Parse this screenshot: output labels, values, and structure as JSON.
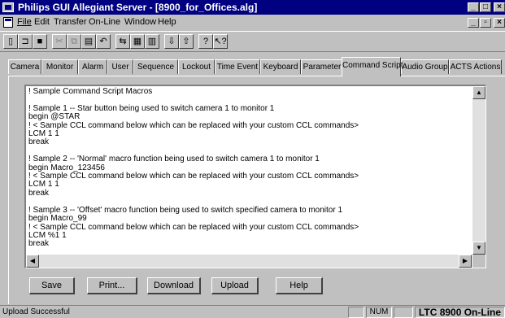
{
  "window": {
    "title": "Philips GUI Allegiant Server - [8900_for_Offices.alg]"
  },
  "menu": {
    "items": [
      "File",
      "Edit",
      "Transfer",
      "On-Line",
      "Window",
      "Help"
    ]
  },
  "toolbar": {
    "icons": [
      "new-icon",
      "open-icon",
      "save-icon",
      "cut-icon",
      "copy-icon",
      "paste-icon",
      "undo-icon",
      "transfer-icon",
      "grid-icon",
      "table-icon",
      "download-icon",
      "upload-icon",
      "help-icon",
      "context-help-icon"
    ]
  },
  "tabs": {
    "items": [
      "Camera",
      "Monitor",
      "Alarm",
      "User",
      "Sequence",
      "Lockout",
      "Time Event",
      "Keyboard",
      "Parameter",
      "Command Script",
      "Audio Group",
      "ACTS Actions"
    ],
    "active": "Command Script"
  },
  "editor": {
    "lines": [
      "! Sample Command Script Macros",
      "",
      "! Sample 1 -- Star button being used to switch camera 1 to monitor 1",
      "begin @STAR",
      "! < Sample CCL command below which can be replaced with your custom CCL commands>",
      "LCM 1 1",
      "break",
      "",
      "! Sample 2 -- 'Normal' macro function being used to switch camera 1 to monitor 1",
      "begin Macro_123456",
      "! < Sample CCL command below which can be replaced with your custom CCL commands>",
      "LCM 1 1",
      "break",
      "",
      "! Sample 3 -- 'Offset' macro function being used to switch specified camera to monitor 1",
      "begin Macro_99",
      "! < Sample CCL command below which can be replaced with your custom CCL commands>",
      "LCM %1 1",
      "break"
    ]
  },
  "buttons": {
    "save": "Save",
    "print": "Print...",
    "download": "Download",
    "upload": "Upload",
    "help": "Help"
  },
  "status": {
    "message": "Upload Successful",
    "num": "NUM",
    "connection": "LTC 8900 On-Line"
  }
}
